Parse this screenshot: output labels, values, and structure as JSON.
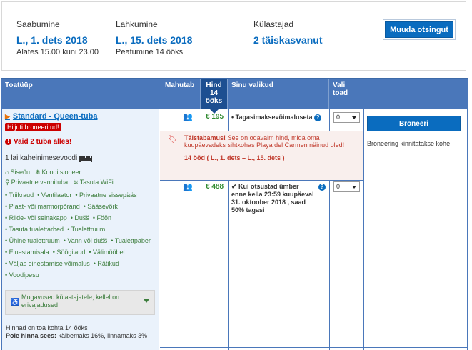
{
  "summary": {
    "checkin": {
      "label": "Saabumine",
      "value": "L., 1. dets 2018",
      "sub": "Alates 15.00 kuni 23.00"
    },
    "checkout": {
      "label": "Lahkumine",
      "value": "L., 15. dets 2018",
      "sub": "Peatumine 14 ööks"
    },
    "guests": {
      "label": "Külastajad",
      "value": "2 täiskasvanut"
    },
    "modify_label": "Muuda otsingut"
  },
  "table": {
    "headers": {
      "room_type": "Toatüüp",
      "capacity": "Mahutab",
      "price_l1": "Hind",
      "price_l2": "14",
      "price_l3": "ööks",
      "choices": "Sinu valikud",
      "select_l1": "Vali",
      "select_l2": "toad"
    },
    "room": {
      "name": "Standard - Queen-tuba",
      "badge": "Hiljuti broneeritud!",
      "warning": "Vaid 2 tuba alles!",
      "bed": "1 lai kaheinimesevoodi",
      "amenities_row1": [
        "Siseõu",
        "Konditsioneer"
      ],
      "amenities_row2": [
        "Privaatne vannituba",
        "Tasuta WiFi"
      ],
      "facilities": [
        [
          "Triikraud",
          "Ventilaator",
          "Privaatne sissepääs"
        ],
        [
          "Plaat- või marmorpõrand",
          "Sääsevõrk"
        ],
        [
          "Riide- või seinakapp",
          "Dušš",
          "Föön"
        ],
        [
          "Tasuta tualettarbed",
          "Tualettruum"
        ],
        [
          "Ühine tualettruum",
          "Vann või dušš",
          "Tualettpaber"
        ],
        [
          "Einestamisala",
          "Söögilaud",
          "Välimööbel"
        ],
        [
          "Väljas einestamise võimalus",
          "Rätikud"
        ],
        [
          "Voodipesu"
        ]
      ],
      "amenities_box": "Mugavused külastajatele, kellel on erivajadused",
      "nights_note": "Hinnad on toa kohta 14 ööks",
      "tax_label": "Pole hinna sees:",
      "tax_text": "käibemaks 16%, linnamaks 3%"
    },
    "options": [
      {
        "price": "€ 195",
        "choice": "Tagasimaksevõimaluseta",
        "qty": "0"
      },
      {
        "price": "€ 488",
        "choice": "Kui otsustad ümber enne kella 23:59 kuupäeval 31. oktoober 2018 , saad 50% tagasi",
        "qty": "0"
      }
    ],
    "promo": {
      "title": "Täistabamus!",
      "text": "See on odavaim hind, mida oma kuupäevadeks sihtkohas Playa del Carmen näinud oled!",
      "dates": "14 ööd ( L., 1. dets – L., 15. dets )"
    },
    "book_label": "Broneeri",
    "book_note": "Broneering kinnitatakse kohe"
  },
  "colors": {
    "accent": "#0a6cbf",
    "header": "#4a77ba",
    "price": "#2f8a2f",
    "alert": "#cc0000"
  }
}
